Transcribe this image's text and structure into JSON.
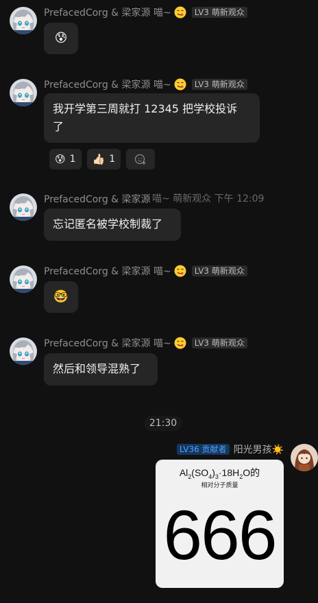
{
  "sender": {
    "name": "PrefacedCorg & 梁家源 喵~",
    "badge": "LV3 萌新观众"
  },
  "messages": [
    {
      "type": "emoji",
      "emoji": "😰"
    },
    {
      "type": "text",
      "line1": "我开学第三周就打 12345 把学校投诉",
      "line2": "了"
    },
    {
      "type": "text",
      "text": "忘记匿名被学校制裁了"
    },
    {
      "type": "emoji",
      "emoji": "🤓"
    },
    {
      "type": "text",
      "text": "然后和领导混熟了"
    }
  ],
  "reactions": [
    {
      "emoji": "😰",
      "count": "1"
    },
    {
      "emoji": "👍🏻",
      "count": "1"
    }
  ],
  "overlap_ghost_text": "喵~ 萌新观众 下午 12:09",
  "time_divider": "21:30",
  "me": {
    "badge": "LV36 贡献者",
    "name": "阳光男孩☀️"
  },
  "image": {
    "formula_al": "Al",
    "formula_sub2": "2",
    "formula_so": "(SO",
    "formula_sub4": "4",
    "formula_close": ")",
    "formula_sub3": "3",
    "formula_h": "·18H",
    "formula_sub2b": "2",
    "formula_tail": "O的",
    "subtitle": "相对分子质量",
    "number": "666"
  },
  "colors": {
    "background": "#111111",
    "bubble": "#262626",
    "badge_blue_text": "#4d9fff"
  }
}
